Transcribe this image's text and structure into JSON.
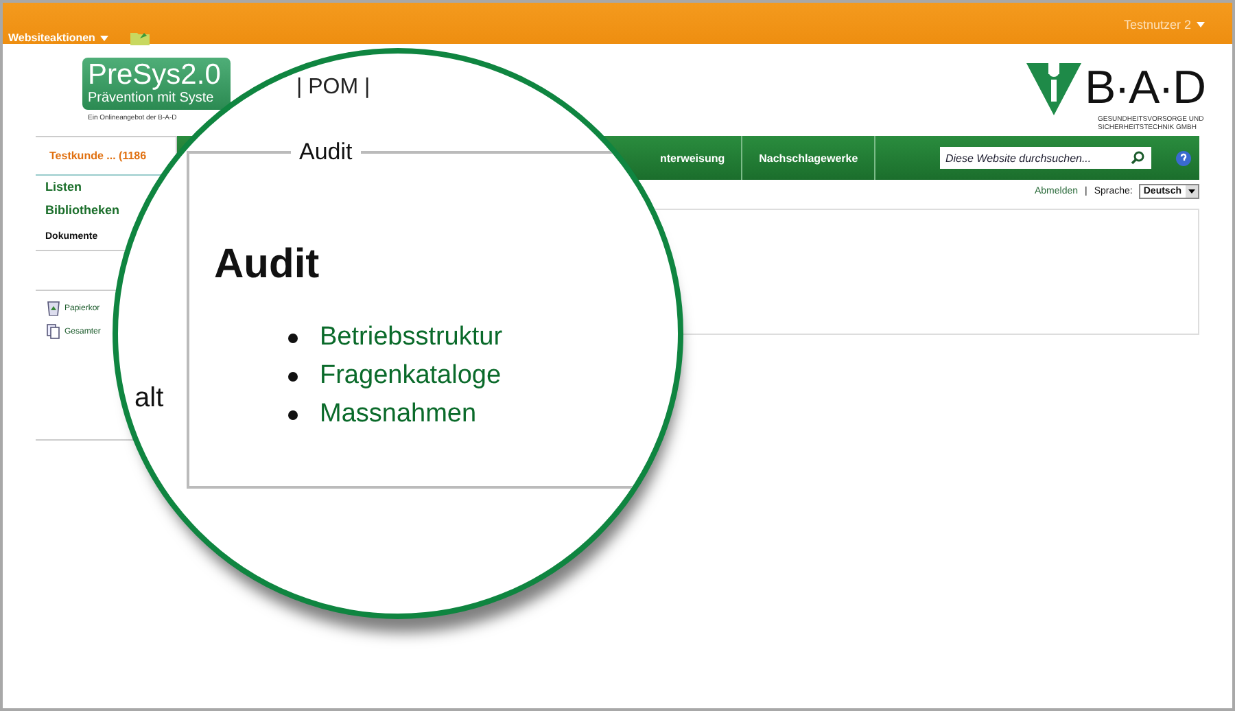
{
  "top_bar": {
    "site_actions": "Websiteaktionen",
    "user": "Testnutzer 2"
  },
  "logo": {
    "name": "PreSys2.0",
    "tagline": "Prävention mit Syste",
    "subline": "Ein Onlineangebot der B-A-D"
  },
  "brand": {
    "name": "B·A·D",
    "line_1": "GESUNDHEITSVORSORGE UND",
    "line_2": "SICHERHEITSTECHNIK GMBH"
  },
  "sidebar": {
    "customer": "Testkunde ... (1186",
    "items": [
      {
        "label": "Listen",
        "selected": false
      },
      {
        "label": "Bibliotheken",
        "selected": false
      },
      {
        "label": "Dokumente",
        "selected": true
      }
    ],
    "links": [
      {
        "label": "Papierkor",
        "kind": "trash"
      },
      {
        "label": "Gesamter",
        "kind": "pages"
      }
    ]
  },
  "nav": {
    "tabs": [
      "nterweisung",
      "Nachschlagewerke"
    ],
    "search": {
      "placeholder": "Diese Website durchsuchen..."
    }
  },
  "user_links": {
    "logout": "Abmelden",
    "separator": "|",
    "language_label": "Sprache:",
    "language": "Deutsch"
  },
  "magnifier": {
    "breadcrumb": "| POM |",
    "side_text": "alt",
    "panel": {
      "legend": "Audit",
      "heading": "Audit",
      "links": [
        "Betriebsstruktur",
        "Fragenkataloge",
        "Massnahmen"
      ]
    }
  }
}
